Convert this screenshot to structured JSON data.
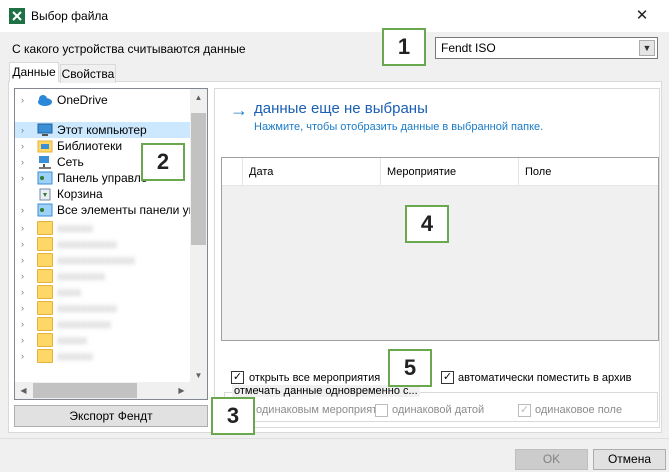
{
  "window": {
    "title": "Выбор файла",
    "close_glyph": "✕",
    "app_icon": "excel-icon"
  },
  "device": {
    "label": "С какого устройства считываются данные",
    "selected": "Fendt ISO"
  },
  "tabs": [
    {
      "label": "Данные",
      "active": true
    },
    {
      "label": "Свойства",
      "active": false
    }
  ],
  "tree": {
    "items": [
      {
        "label": "OneDrive",
        "icon": "cloud-icon"
      },
      {
        "label": "Этот компьютер",
        "icon": "computer-icon",
        "selected": true
      },
      {
        "label": "Библиотеки",
        "icon": "library-icon"
      },
      {
        "label": "Сеть",
        "icon": "network-icon"
      },
      {
        "label": "Панель управле",
        "icon": "control-panel-icon"
      },
      {
        "label": "Корзина",
        "icon": "recycle-bin-icon"
      },
      {
        "label": "Все элементы панели упра",
        "icon": "control-panel-icon"
      }
    ],
    "blurred_folders": [
      "xxxxxx",
      "xxxxxxxxxx",
      "xxxxxxxxxxxxx",
      "xxxxxxxx",
      "xxxx",
      "xxxxxxxxxx",
      "xxxxxxxxx",
      "xxxxx",
      "xxxxxx"
    ]
  },
  "export_button": "Экспорт Фендт",
  "status": {
    "arrow": "→",
    "title": "данные еще не выбраны",
    "hint": "Нажмите, чтобы отобразить данные в выбранной папке."
  },
  "grid": {
    "columns": [
      "Дата",
      "Мероприятие",
      "Поле"
    ]
  },
  "options": {
    "open_all": {
      "label": "открыть все мероприятия",
      "checked": true
    },
    "auto_archive": {
      "label": "автоматически поместить в архив",
      "checked": true
    },
    "group_title": "отмечать данные одновременно с...",
    "same_event": {
      "label": "одинаковым мероприят",
      "checked": false
    },
    "same_date": {
      "label": "одинаковой датой",
      "checked": false
    },
    "same_field": {
      "label": "одинаковое поле",
      "checked": true
    }
  },
  "footer": {
    "ok": "OK",
    "cancel": "Отмена"
  },
  "callouts": [
    "1",
    "2",
    "3",
    "4",
    "5"
  ],
  "colors": {
    "accent": "#1a7bc6",
    "callout_border": "#6aa84f",
    "selection": "#cce8ff"
  }
}
